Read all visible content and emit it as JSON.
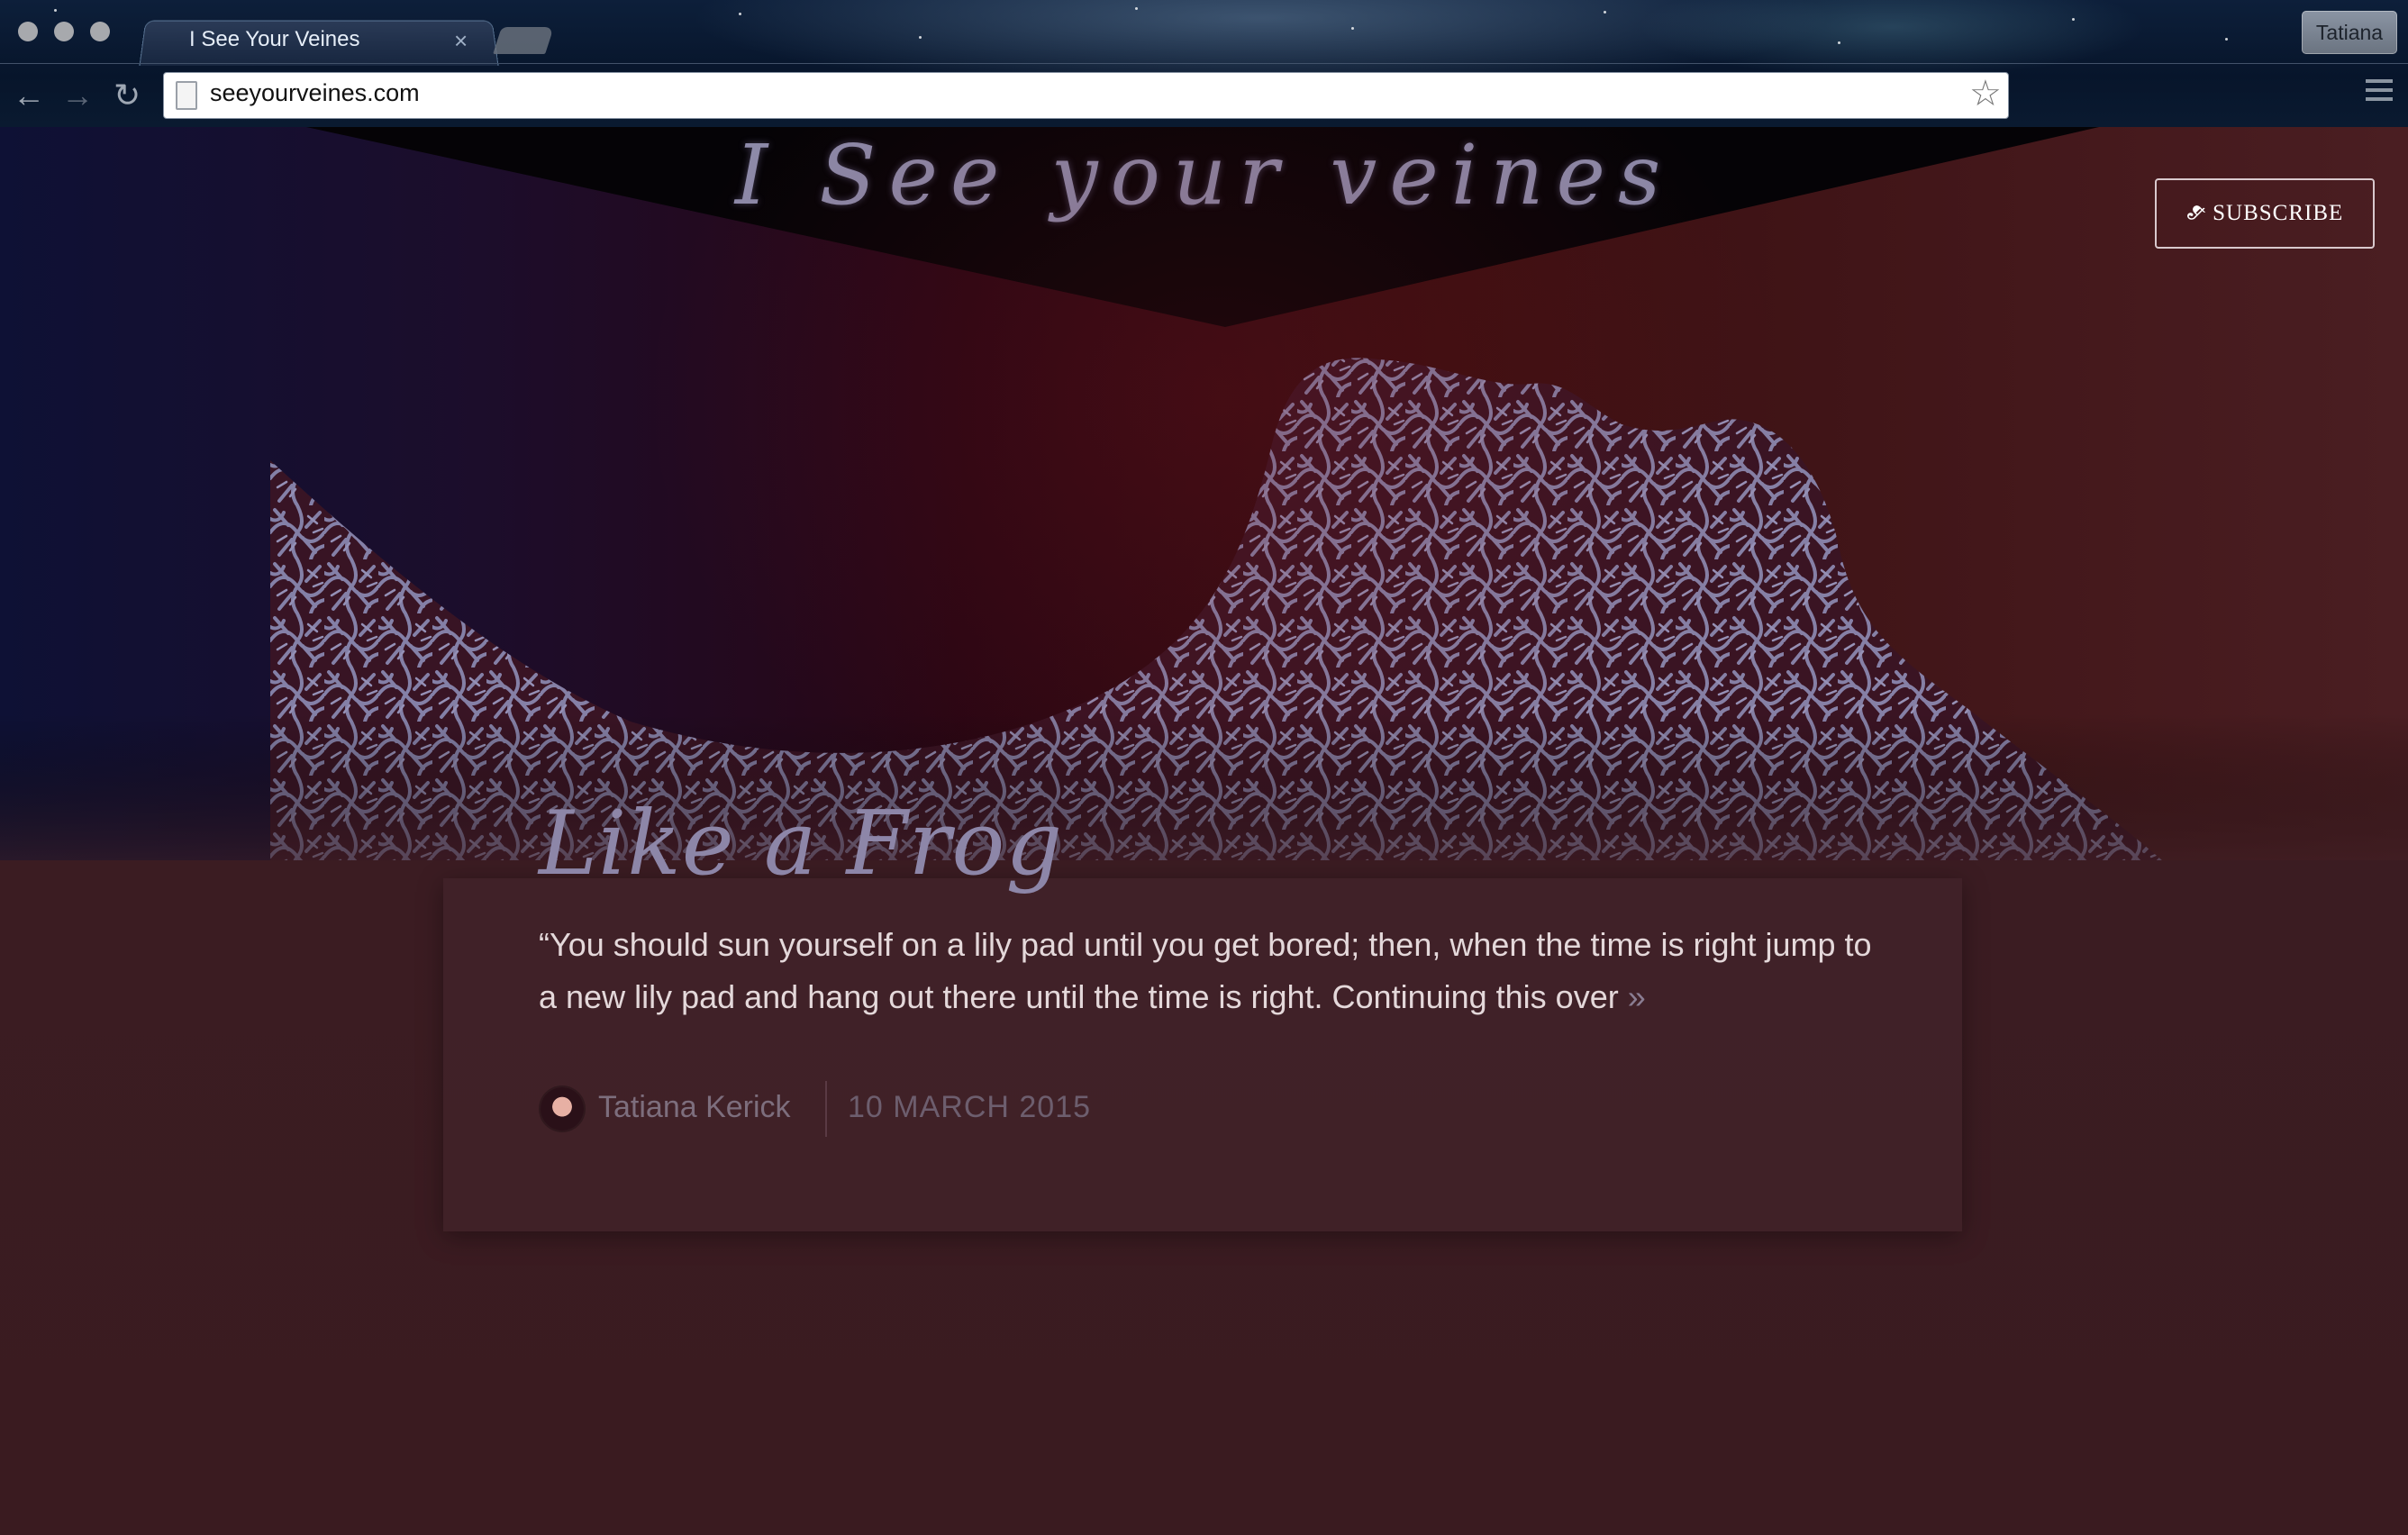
{
  "browser": {
    "tab_title": "I See Your Veines",
    "tab_close": "×",
    "profile_name": "Tatiana",
    "url": "seeyourveines.com",
    "back_icon": "arrow-left-icon",
    "forward_icon": "arrow-right-icon",
    "reload_icon": "reload-icon",
    "bookmark_icon": "star-outline-icon",
    "menu_icon": "hamburger-menu-icon"
  },
  "site": {
    "title": "I See your veines",
    "subscribe_label": "SUBSCRIBE",
    "subscribe_icon": "rss-icon",
    "accent_color": "#8d86a8",
    "background_color": "#3a1d22"
  },
  "post": {
    "title": "Like a Frog",
    "excerpt": "“You should sun yourself on a lily pad until you get bored; then, when the time is right jump to a new lily pad and hang out there until the time is right. Continuing this over",
    "read_more": "»",
    "author": "Tatiana Kerick",
    "date": "10 MARCH 2015"
  }
}
